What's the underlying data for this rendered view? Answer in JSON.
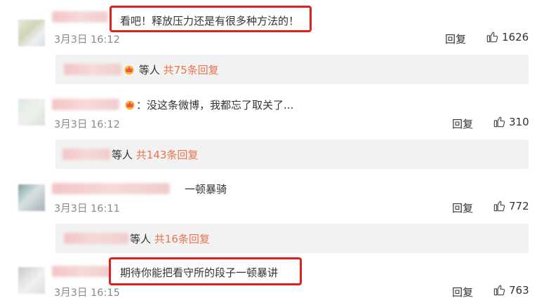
{
  "reply_label": "回复",
  "accent_color": "#eb7350",
  "highlight_color": "#e0201b",
  "comments": [
    {
      "text": "看吧！释放压力还是有很多种方法的！",
      "time": "3月3日 16:12",
      "likes": "1626",
      "sub_text": "等人",
      "sub_count": "共75条回复"
    },
    {
      "text": "：没这条微博，我都忘了取关了...",
      "time": "3月3日 16:12",
      "likes": "310",
      "sub_text": "等人",
      "sub_count": "共143条回复"
    },
    {
      "text": "一顿暴骑",
      "time": "3月3日 16:11",
      "likes": "772",
      "sub_text": "等人",
      "sub_count": "共16条回复"
    },
    {
      "text": "期待你能把看守所的段子一顿暴讲",
      "time": "3月3日 16:15",
      "likes": "763"
    }
  ]
}
